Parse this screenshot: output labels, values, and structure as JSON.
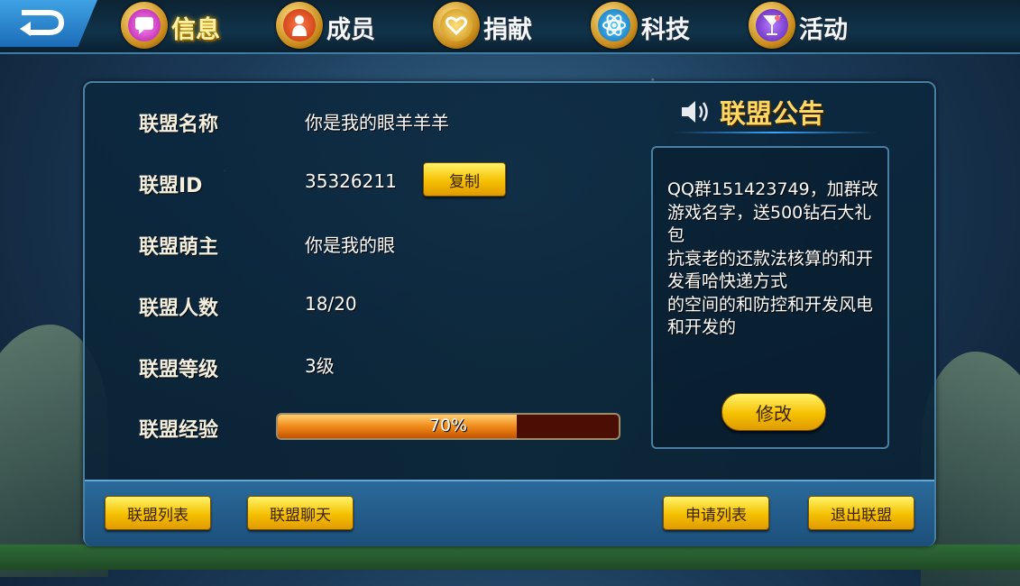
{
  "tabs": [
    {
      "label": "信息",
      "icon": "chat-bubble-icon",
      "active": true
    },
    {
      "label": "成员",
      "icon": "person-icon",
      "active": false
    },
    {
      "label": "捐献",
      "icon": "heart-icon",
      "active": false
    },
    {
      "label": "科技",
      "icon": "atom-icon",
      "active": false
    },
    {
      "label": "活动",
      "icon": "cocktail-icon",
      "active": false
    }
  ],
  "info": {
    "name_label": "联盟名称",
    "name_value": "你是我的眼羊羊羊",
    "id_label": "联盟ID",
    "id_value": "35326211",
    "copy_button": "复制",
    "leader_label": "联盟萌主",
    "leader_value": "你是我的眼",
    "members_label": "联盟人数",
    "members_value": "18/20",
    "level_label": "联盟等级",
    "level_value": "3级",
    "exp_label": "联盟经验",
    "exp_percent_text": "70%",
    "exp_fraction": 0.7
  },
  "notice": {
    "title": "联盟公告",
    "text": "QQ群151423749，加群改游戏名字，送500钻石大礼包\n抗衰老的还款法核算的和开发看哈快递方式\n的空间的和防控和开发风电和开发的",
    "modify_button": "修改"
  },
  "bottom_buttons": {
    "alliance_list": "联盟列表",
    "alliance_chat": "联盟聊天",
    "apply_list": "申请列表",
    "leave_alliance": "退出联盟"
  },
  "colors": {
    "accent_yellow": "#f5c000",
    "title_gold": "#ffd861",
    "panel_border": "#4a7fa4",
    "progress_fill": "#f08a1a"
  }
}
